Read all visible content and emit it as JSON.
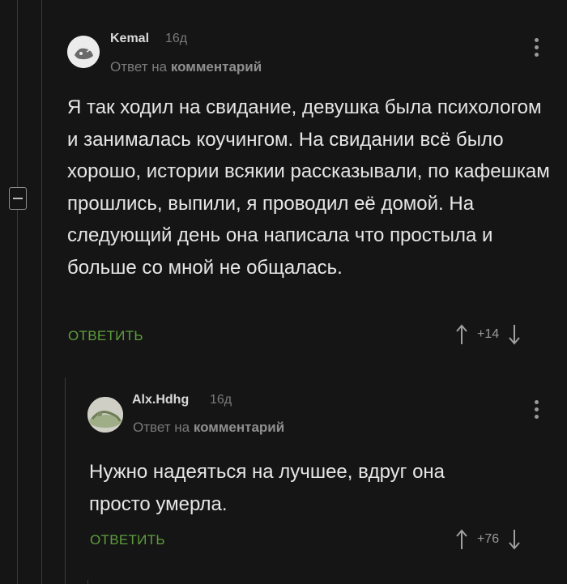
{
  "comments": [
    {
      "author": "Kemal",
      "time": "16д",
      "reply_prefix": "Ответ на",
      "reply_target": "комментарий",
      "text": "Я так ходил на свидание, девушка была психологом и занималась коучингом. На свидании всё было хорошо, истории всякии рассказывали, по кафешкам прошлись, выпили, я проводил её домой. На следующий день она написала что простыла и больше со мной не общалась.",
      "reply_label": "ОТВЕТИТЬ",
      "score": "+14"
    },
    {
      "author": "Alx.Hdhg",
      "time": "16д",
      "reply_prefix": "Ответ на",
      "reply_target": "комментарий",
      "text": "Нужно надеяться на лучшее, вдруг она просто умерла.",
      "reply_label": "ОТВЕТИТЬ",
      "score": "+76"
    }
  ],
  "colors": {
    "background": "#151515",
    "accent": "#5d9e3d",
    "muted": "#7a7a7a"
  },
  "icons": {
    "collapse": "minus-square-icon",
    "menu": "kebab-menu-icon",
    "upvote": "arrow-up-icon",
    "downvote": "arrow-down-icon"
  }
}
